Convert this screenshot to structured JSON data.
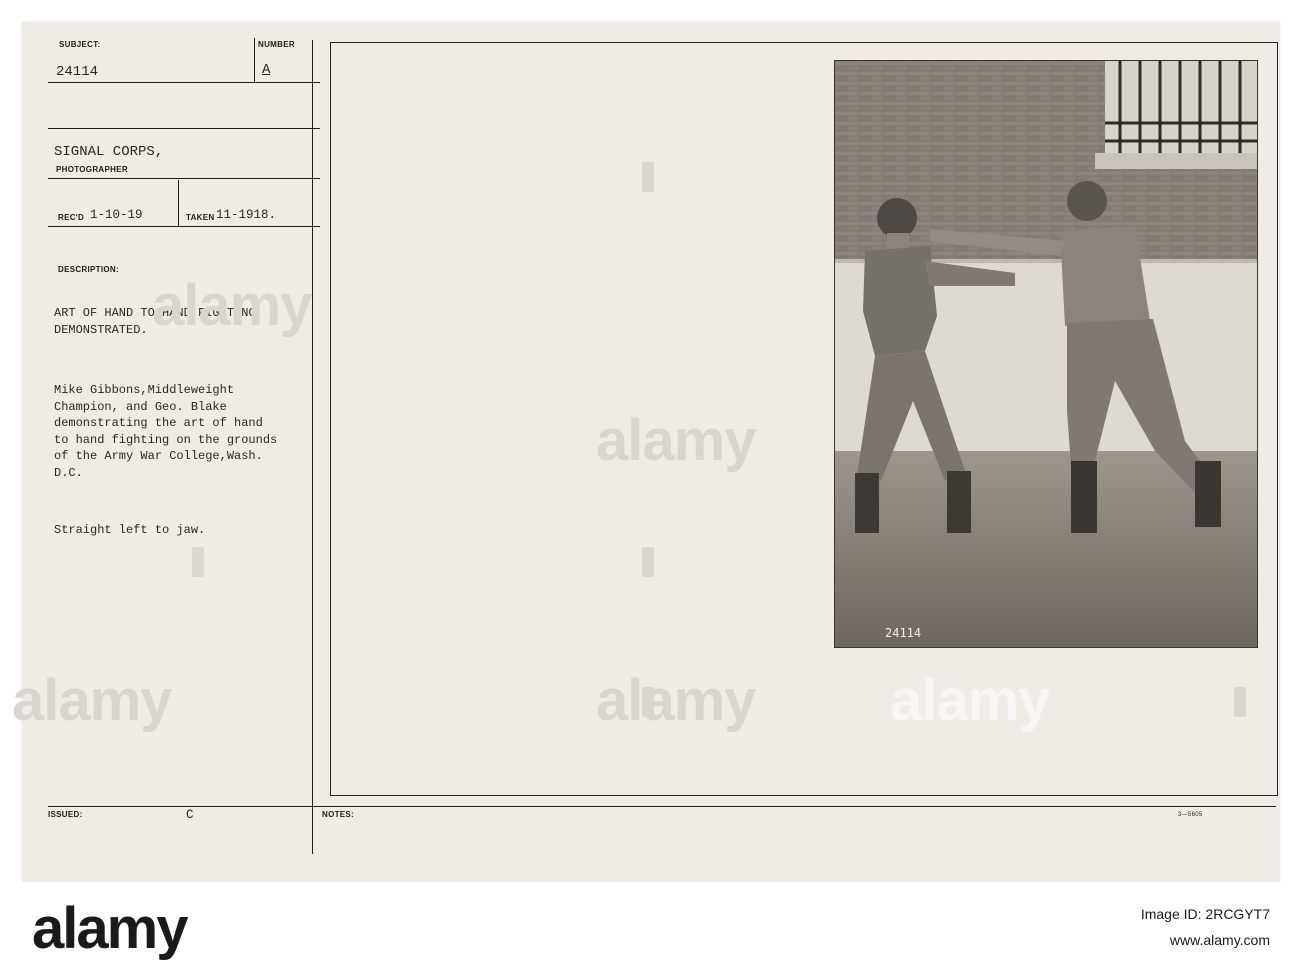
{
  "card": {
    "labels": {
      "subject": "SUBJECT:",
      "number": "NUMBER",
      "photographer": "PHOTOGRAPHER",
      "recd": "REC'D",
      "taken": "TAKEN",
      "description": "DESCRIPTION:",
      "issued": "ISSUED:",
      "notes": "NOTES:"
    },
    "subject_value": "24114",
    "number_value": "A",
    "photographer_value": "SIGNAL CORPS,",
    "recd_value": "1-10-19",
    "taken_value": "11-1918.",
    "description_title": "ART OF HAND TO HAND FIGHTING\nDEMONSTRATED.",
    "description_body": "Mike Gibbons,Middleweight\nChampion, and Geo. Blake\ndemonstrating the art of hand\nto hand fighting on the grounds\nof the Army War College,Wash.\nD.C.",
    "caption": "Straight left to jaw.",
    "issued_value": "C",
    "form_number": "3—5605",
    "photo_number": "24114"
  },
  "watermark": "alamy",
  "footer": {
    "logo": "alamy",
    "image_id": "Image ID: 2RCGYT7",
    "url": "www.alamy.com"
  }
}
